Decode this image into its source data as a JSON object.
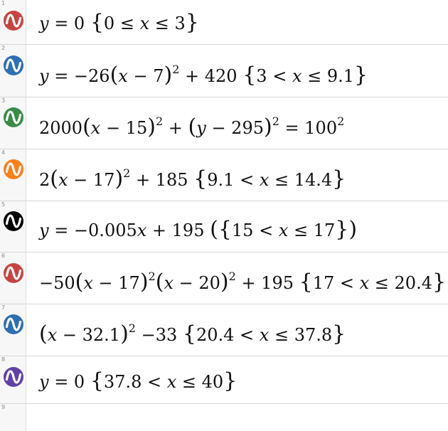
{
  "rows": [
    {
      "num": "1",
      "color": "#c74440",
      "icon": "curve-icon"
    },
    {
      "num": "2",
      "color": "#2d70b3",
      "icon": "curve-icon"
    },
    {
      "num": "3",
      "color": "#388c46",
      "icon": "curve-icon"
    },
    {
      "num": "4",
      "color": "#fa7e19",
      "icon": "curve-icon"
    },
    {
      "num": "5",
      "color": "#000000",
      "icon": "curve-icon"
    },
    {
      "num": "6",
      "color": "#c74440",
      "icon": "curve-icon"
    },
    {
      "num": "7",
      "color": "#2d70b3",
      "icon": "curve-icon"
    },
    {
      "num": "8",
      "color": "#6042a6",
      "icon": "curve-icon"
    },
    {
      "num": "9"
    }
  ],
  "exprs": {
    "e1": {
      "a": "y",
      "b": " = 0 ",
      "c": "0 ≤ ",
      "d": "x",
      "e": " ≤ 3"
    },
    "e2": {
      "a": "y",
      "b": " = −26",
      "c": "x",
      "d": " − 7",
      "e": "2",
      "f": " + 420 ",
      "g": "3 < ",
      "h": "x",
      "i": " ≤ 9.1"
    },
    "e3": {
      "a": "2000",
      "b": "x",
      "c": " − 15",
      "d": "2",
      "e": " + ",
      "f": "y",
      "g": " − 295",
      "h": "2",
      "i": " = 100",
      "j": "2"
    },
    "e4": {
      "a": "2",
      "b": "x",
      "c": " − 17",
      "d": "2",
      "e": " + 185 ",
      "f": "9.1 < ",
      "g": "x",
      "h": " ≤ 14.4"
    },
    "e5": {
      "a": "y",
      "b": " = −0.005",
      "c": "x",
      "d": " + 195 ",
      "e": "15 < ",
      "f": "x",
      "g": " ≤ 17"
    },
    "e6": {
      "a": "−50",
      "b": "x",
      "c": " − 17",
      "d": "2",
      "e": "x",
      "f": " − 20",
      "g": "2",
      "h": " + 195 ",
      "i": "17 < ",
      "j": "x",
      "k": " ≤ 20.4"
    },
    "e7": {
      "a": "x",
      "b": " − 32.1",
      "c": "2",
      "d": " −33 ",
      "e": "20.4 < ",
      "f": "x",
      "g": " ≤ 37.8"
    },
    "e8": {
      "a": "y",
      "b": " = 0 ",
      "c": "37.8 < ",
      "d": "x",
      "e": " ≤ 40"
    }
  }
}
